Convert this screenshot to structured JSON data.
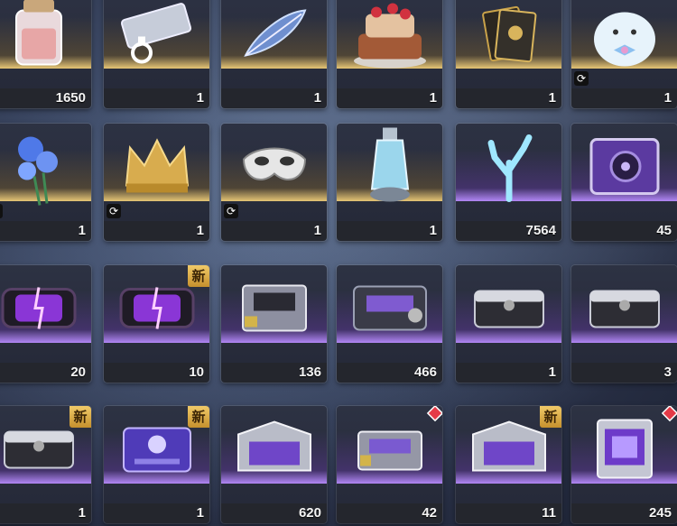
{
  "inventory": {
    "rows": [
      {
        "items": [
          {
            "name": "salt-jar",
            "qty": "1650",
            "rarity": "gold",
            "timer": false,
            "badge": null
          },
          {
            "name": "ticket",
            "qty": "1",
            "rarity": "gold",
            "timer": false,
            "badge": null
          },
          {
            "name": "blue-feather",
            "qty": "1",
            "rarity": "gold",
            "timer": false,
            "badge": null
          },
          {
            "name": "cake",
            "qty": "1",
            "rarity": "gold",
            "timer": false,
            "badge": null
          },
          {
            "name": "card-pack",
            "qty": "1",
            "rarity": "gold",
            "timer": false,
            "badge": null
          },
          {
            "name": "plush-seal",
            "qty": "1",
            "rarity": "gold",
            "timer": true,
            "badge": null
          }
        ]
      },
      {
        "items": [
          {
            "name": "blue-bouquet",
            "qty": "1",
            "rarity": "gold",
            "timer": true,
            "badge": null
          },
          {
            "name": "gold-crown",
            "qty": "1",
            "rarity": "gold",
            "timer": true,
            "badge": null
          },
          {
            "name": "masquerade-mask",
            "qty": "1",
            "rarity": "gold",
            "timer": true,
            "badge": null
          },
          {
            "name": "potion-vial",
            "qty": "1",
            "rarity": "gold",
            "timer": false,
            "badge": null
          },
          {
            "name": "crystal-coral",
            "qty": "7564",
            "rarity": "purple",
            "timer": false,
            "badge": null
          },
          {
            "name": "speaker-box",
            "qty": "45",
            "rarity": "purple",
            "timer": false,
            "badge": null
          }
        ]
      },
      {
        "items": [
          {
            "name": "purple-capsule",
            "qty": "20",
            "rarity": "purple",
            "timer": false,
            "badge": null
          },
          {
            "name": "purple-capsule",
            "qty": "10",
            "rarity": "purple",
            "timer": false,
            "badge": "新"
          },
          {
            "name": "supply-crate",
            "qty": "136",
            "rarity": "purple",
            "timer": false,
            "badge": null
          },
          {
            "name": "dark-crate",
            "qty": "466",
            "rarity": "purple",
            "timer": false,
            "badge": null
          },
          {
            "name": "gray-crate",
            "qty": "1",
            "rarity": "purple",
            "timer": false,
            "badge": null
          },
          {
            "name": "gray-crate",
            "qty": "3",
            "rarity": "purple",
            "timer": false,
            "badge": null
          }
        ]
      },
      {
        "items": [
          {
            "name": "gray-crate",
            "qty": "1",
            "rarity": "purple",
            "timer": false,
            "badge": "新"
          },
          {
            "name": "purple-case",
            "qty": "1",
            "rarity": "purple",
            "timer": false,
            "badge": "新"
          },
          {
            "name": "silver-chest",
            "qty": "620",
            "rarity": "purple",
            "timer": false,
            "badge": null
          },
          {
            "name": "small-crate",
            "qty": "42",
            "rarity": "purple",
            "timer": false,
            "badge": "dot"
          },
          {
            "name": "silver-chest",
            "qty": "11",
            "rarity": "purple",
            "timer": false,
            "badge": "新"
          },
          {
            "name": "glass-cube",
            "qty": "245",
            "rarity": "purple",
            "timer": false,
            "badge": "dot"
          }
        ]
      }
    ],
    "timer_glyph": "⟳",
    "colors": {
      "gold": "#f0cd78",
      "purple": "#b98cff",
      "new_badge": "#e3b24b",
      "alert_dot": "#e53a47"
    }
  }
}
